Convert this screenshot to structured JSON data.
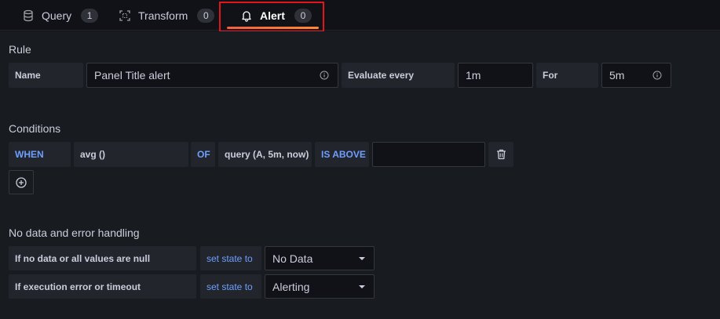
{
  "tabs": [
    {
      "label": "Query",
      "count": "1",
      "icon": "database-icon"
    },
    {
      "label": "Transform",
      "count": "0",
      "icon": "transform-icon"
    },
    {
      "label": "Alert",
      "count": "0",
      "icon": "bell-icon",
      "active": true
    }
  ],
  "rule": {
    "title": "Rule",
    "name_label": "Name",
    "name_value": "Panel Title alert",
    "evaluate_label": "Evaluate every",
    "evaluate_value": "1m",
    "for_label": "For",
    "for_value": "5m"
  },
  "conditions": {
    "title": "Conditions",
    "when": "WHEN",
    "func": "avg ()",
    "of": "OF",
    "query": "query (A, 5m, now)",
    "evaluator": "IS ABOVE",
    "threshold": ""
  },
  "nodata": {
    "title": "No data and error handling",
    "rows": [
      {
        "label": "If no data or all values are null",
        "action": "set state to",
        "value": "No Data"
      },
      {
        "label": "If execution error or timeout",
        "action": "set state to",
        "value": "Alerting"
      }
    ]
  },
  "colors": {
    "accent": "#6e9fff",
    "active_tab": "#f55f3e",
    "highlight": "#e0161e"
  }
}
